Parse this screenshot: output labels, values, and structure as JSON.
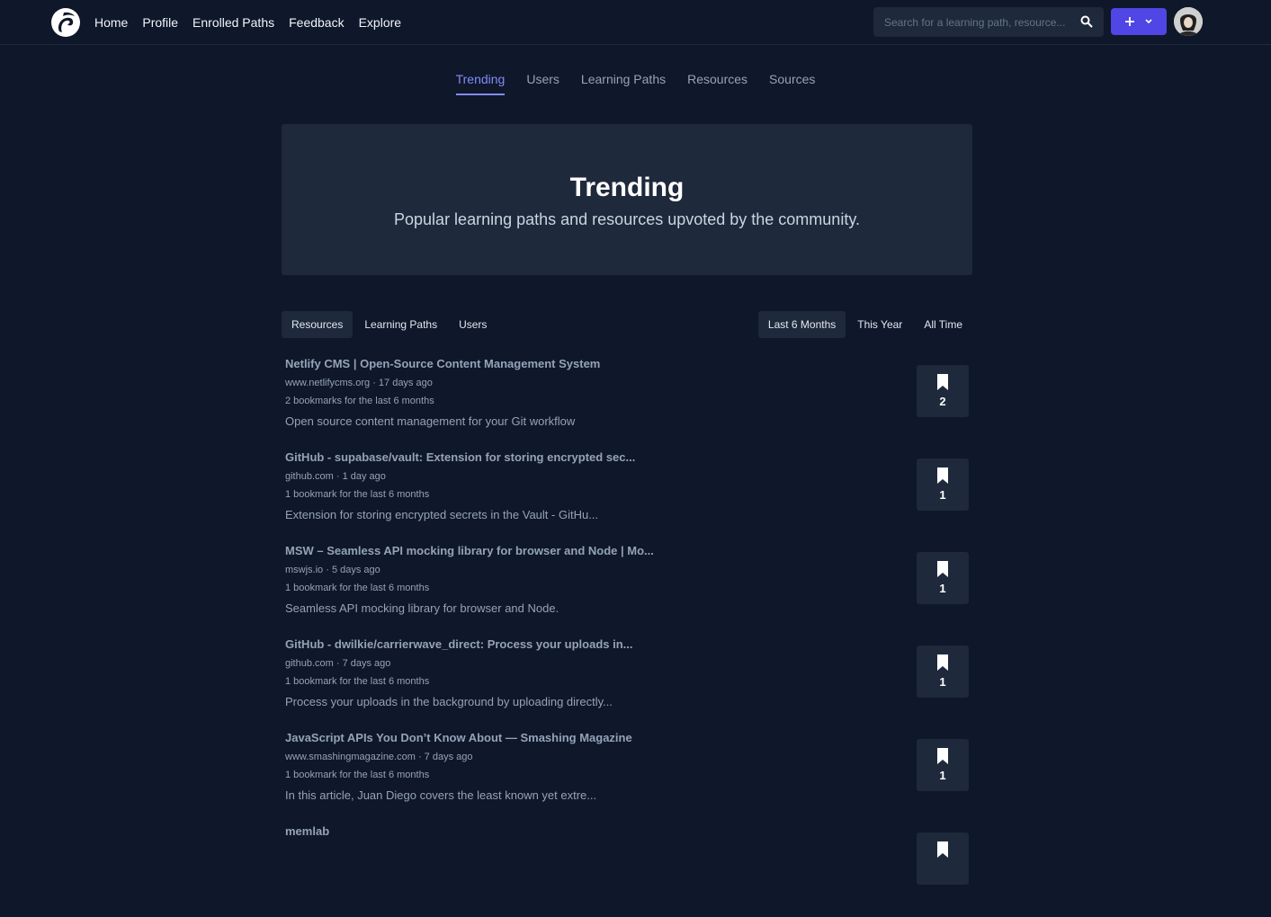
{
  "nav": {
    "links": [
      "Home",
      "Profile",
      "Enrolled Paths",
      "Feedback",
      "Explore"
    ],
    "search_placeholder": "Search for a learning path, resource..."
  },
  "tabs": [
    "Trending",
    "Users",
    "Learning Paths",
    "Resources",
    "Sources"
  ],
  "active_tab": "Trending",
  "hero": {
    "title": "Trending",
    "subtitle": "Popular learning paths and resources upvoted by the community."
  },
  "type_filters": [
    "Resources",
    "Learning Paths",
    "Users"
  ],
  "time_filters": [
    "Last 6 Months",
    "This Year",
    "All Time"
  ],
  "resources": [
    {
      "title": "Netlify CMS | Open-Source Content Management System",
      "meta": "www.netlifycms.org · 17 days ago",
      "bookmarks_text": "2 bookmarks for the last 6 months",
      "description": "Open source content management for your Git workflow",
      "count": "2"
    },
    {
      "title": "GitHub - supabase/vault: Extension for storing encrypted sec...",
      "meta": "github.com · 1 day ago",
      "bookmarks_text": "1 bookmark for the last 6 months",
      "description": "Extension for storing encrypted secrets in the Vault - GitHu...",
      "count": "1"
    },
    {
      "title": "MSW – Seamless API mocking library for browser and Node | Mo...",
      "meta": "mswjs.io · 5 days ago",
      "bookmarks_text": "1 bookmark for the last 6 months",
      "description": "Seamless API mocking library for browser and Node.",
      "count": "1"
    },
    {
      "title": "GitHub - dwilkie/carrierwave_direct: Process your uploads in...",
      "meta": "github.com · 7 days ago",
      "bookmarks_text": "1 bookmark for the last 6 months",
      "description": "Process your uploads in the background by uploading directly...",
      "count": "1"
    },
    {
      "title": "JavaScript APIs You Don’t Know About — Smashing Magazine",
      "meta": "www.smashingmagazine.com · 7 days ago",
      "bookmarks_text": "1 bookmark for the last 6 months",
      "description": "In this article, Juan Diego covers the least known yet extre...",
      "count": "1"
    },
    {
      "title": "memlab",
      "meta": "",
      "bookmarks_text": "",
      "description": "",
      "count": ""
    }
  ],
  "colors": {
    "background": "#0f172a",
    "card": "#1e293b",
    "accent": "#818cf8",
    "button": "#4f46e5"
  }
}
